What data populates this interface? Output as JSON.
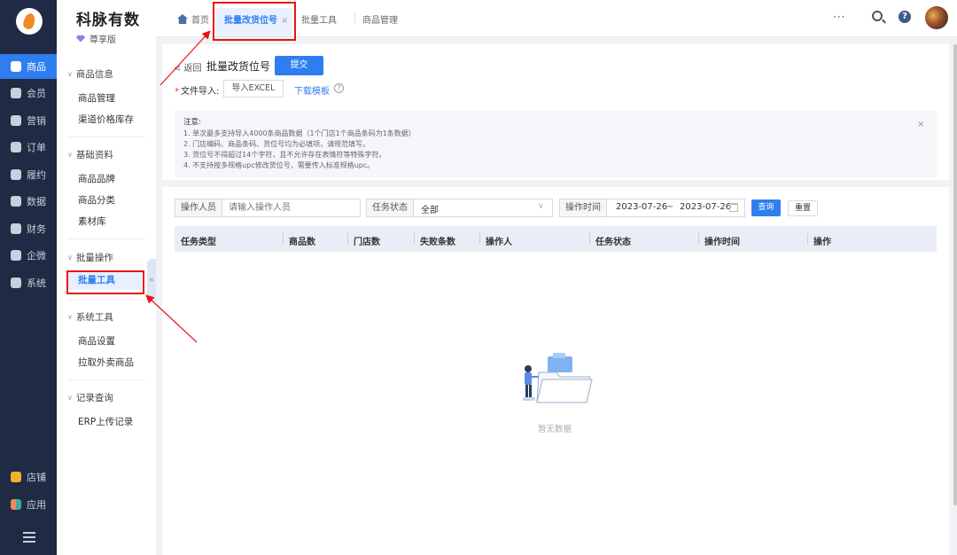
{
  "rail": {
    "items": [
      {
        "label": "商品",
        "icon": "box-icon",
        "active": true
      },
      {
        "label": "会员",
        "icon": "member-icon"
      },
      {
        "label": "营销",
        "icon": "marketing-icon"
      },
      {
        "label": "订单",
        "icon": "order-icon"
      },
      {
        "label": "履约",
        "icon": "delivery-icon"
      },
      {
        "label": "数据",
        "icon": "data-icon"
      },
      {
        "label": "财务",
        "icon": "finance-icon"
      },
      {
        "label": "企微",
        "icon": "wecom-icon"
      },
      {
        "label": "系统",
        "icon": "gear-icon"
      }
    ],
    "bottom": [
      {
        "label": "店铺",
        "icon": "store-icon"
      },
      {
        "label": "应用",
        "icon": "apps-icon"
      }
    ]
  },
  "brand": {
    "name": "科脉有数",
    "edition": "尊享版"
  },
  "sidebar": {
    "groups": [
      {
        "title": "商品信息",
        "items": [
          "商品管理",
          "渠道价格库存"
        ]
      },
      {
        "title": "基础资料",
        "items": [
          "商品品牌",
          "商品分类",
          "素材库"
        ]
      },
      {
        "title": "批量操作",
        "items": [
          "批量工具"
        ]
      },
      {
        "title": "系统工具",
        "items": [
          "商品设置",
          "拉取外卖商品"
        ]
      },
      {
        "title": "记录查询",
        "items": [
          "ERP上传记录"
        ]
      }
    ],
    "collapse_glyph": "«"
  },
  "tabs": {
    "home": "首页",
    "active": "批量改货位号",
    "close": "×",
    "others": [
      "批量工具",
      "商品管理"
    ]
  },
  "topbar": {
    "more": "···",
    "help": "?"
  },
  "form": {
    "back": "< 返回",
    "title": "批量改货位号",
    "submit": "提交",
    "file_label": "文件导入:",
    "required_mark": "*",
    "import_btn": "导入EXCEL",
    "download": "下载模板",
    "help_mark": "?"
  },
  "notice": {
    "title": "注意:",
    "lines": [
      "1. 单次最多支持导入4000条商品数据（1个门店1个商品条码为1条数据）",
      "2. 门店编码、商品条码、货位号均为必填项，请规范填写。",
      "3. 货位号不得超过14个字符，且不允许存在表情符等特殊字符。",
      "4. 不支持按多规格upc修改货位号，需要传入标准规格upc。"
    ],
    "close": "×"
  },
  "filters": {
    "operator_label": "操作人员",
    "operator_placeholder": "请输入操作人员",
    "status_label": "任务状态",
    "status_value": "全部",
    "time_label": "操作时间",
    "date_start": "2023-07-26",
    "date_sep": "~",
    "date_end": "2023-07-26",
    "query": "查询",
    "reset": "重置"
  },
  "table": {
    "columns": [
      "任务类型",
      "商品数",
      "门店数",
      "失败条数",
      "操作人",
      "任务状态",
      "操作时间",
      "操作"
    ],
    "rows": [],
    "empty_text": "暂无数据"
  },
  "colors": {
    "accent": "#2f7ef0",
    "rail_bg": "#1f2a44",
    "callout": "#e11111"
  }
}
